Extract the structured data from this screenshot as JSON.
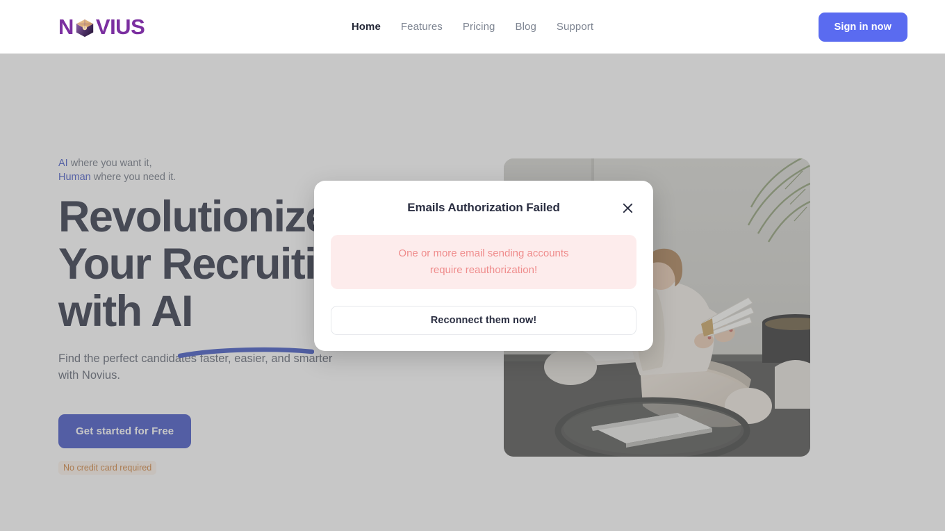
{
  "header": {
    "brand": {
      "prefix": "N",
      "suffix": "VIUS",
      "cube_icon": "cube-icon"
    },
    "nav": [
      {
        "label": "Home",
        "active": true
      },
      {
        "label": "Features",
        "active": false
      },
      {
        "label": "Pricing",
        "active": false
      },
      {
        "label": "Blog",
        "active": false
      },
      {
        "label": "Support",
        "active": false
      }
    ],
    "signin_label": "Sign in now"
  },
  "hero": {
    "eyebrow_line1_hl": "AI",
    "eyebrow_line1_rest": " where you want it,",
    "eyebrow_line2_hl": "Human",
    "eyebrow_line2_rest": " where you need it.",
    "title_line1": "Revolutionize",
    "title_line2": "Your Recruiting",
    "title_line3": "with AI",
    "subtitle": "Find the perfect candidates faster, easier, and smarter with Novius.",
    "cta_label": "Get started for Free",
    "no_card_label": "No credit card required",
    "image_alt": "woman-reading-papers-in-chair"
  },
  "modal": {
    "title": "Emails Authorization Failed",
    "close_icon": "close-icon",
    "alert_line1": "One or more email sending accounts",
    "alert_line2": "require reauthorization!",
    "action_label": "Reconnect them now!"
  },
  "colors": {
    "brand_purple": "#7b2fa0",
    "accent_indigo": "#3f51c5",
    "signin_blue": "#5a6bf0",
    "alert_bg": "#fdecec",
    "alert_text": "#ef8c8c",
    "badge_orange": "#d08139",
    "heading_dark": "#2b2f42",
    "overlay": "rgba(114,114,114,0.40)"
  }
}
